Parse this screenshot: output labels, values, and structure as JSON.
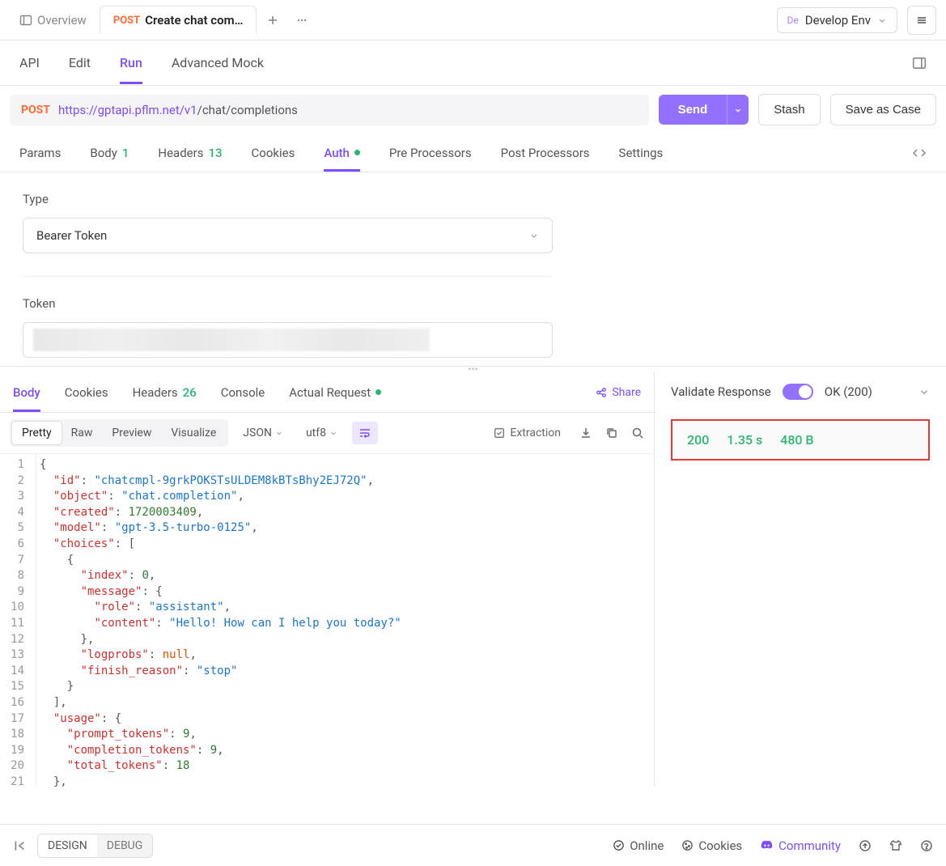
{
  "topTabs": {
    "overview": "Overview",
    "method": "POST",
    "title": "Create chat com…"
  },
  "env": {
    "badge": "De",
    "label": "Develop Env"
  },
  "secNav": {
    "api": "API",
    "edit": "Edit",
    "run": "Run",
    "mock": "Advanced Mock"
  },
  "url": {
    "method": "POST",
    "host": "https://gptapi.pflm.net/v1",
    "path": "/chat/completions"
  },
  "actions": {
    "send": "Send",
    "stash": "Stash",
    "saveCase": "Save as Case"
  },
  "reqTabs": {
    "params": "Params",
    "body": "Body",
    "bodyCount": "1",
    "headers": "Headers",
    "headersCount": "13",
    "cookies": "Cookies",
    "auth": "Auth",
    "pre": "Pre Processors",
    "post": "Post Processors",
    "settings": "Settings"
  },
  "auth": {
    "typeLabel": "Type",
    "typeValue": "Bearer Token",
    "tokenLabel": "Token"
  },
  "respTabs": {
    "body": "Body",
    "cookies": "Cookies",
    "headers": "Headers",
    "headersCount": "26",
    "console": "Console",
    "actualReq": "Actual Request",
    "share": "Share"
  },
  "viewModes": {
    "pretty": "Pretty",
    "raw": "Raw",
    "preview": "Preview",
    "visualize": "Visualize"
  },
  "format": {
    "type": "JSON",
    "encoding": "utf8"
  },
  "extraction": "Extraction",
  "validate": {
    "label": "Validate Response",
    "status": "OK (200)"
  },
  "metrics": {
    "code": "200",
    "time": "1.35 s",
    "size": "480 B"
  },
  "footer": {
    "design": "DESIGN",
    "debug": "DEBUG",
    "online": "Online",
    "cookies": "Cookies",
    "community": "Community"
  },
  "json": {
    "id": "chatcmpl-9grkPOKSTsULDEM8kBTsBhy2EJ72Q",
    "object": "chat.completion",
    "created": 1720003409,
    "model": "gpt-3.5-turbo-0125",
    "choices_index": 0,
    "role": "assistant",
    "content": "Hello! How can I help you today?",
    "logprobs": "null",
    "finish_reason": "stop",
    "prompt_tokens": 9,
    "completion_tokens": 9,
    "total_tokens": 18
  }
}
